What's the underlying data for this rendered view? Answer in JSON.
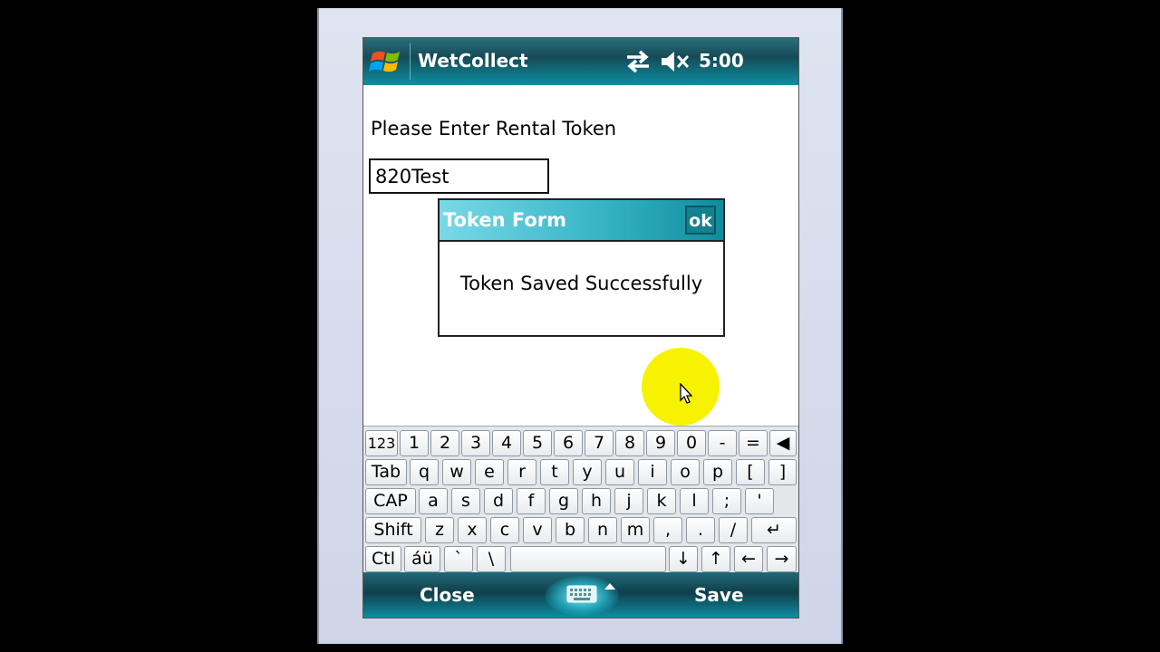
{
  "titlebar": {
    "app_title": "WetCollect",
    "time": "5:00"
  },
  "form": {
    "prompt": "Please Enter Rental Token",
    "token_value": "820Test"
  },
  "dialog": {
    "title": "Token Form",
    "ok_label": "ok",
    "message": "Token Saved Successfully"
  },
  "keyboard": {
    "row1": [
      "123",
      "1",
      "2",
      "3",
      "4",
      "5",
      "6",
      "7",
      "8",
      "9",
      "0",
      "-",
      "=",
      "◀"
    ],
    "row2": [
      "Tab",
      "q",
      "w",
      "e",
      "r",
      "t",
      "y",
      "u",
      "i",
      "o",
      "p",
      "[",
      "]"
    ],
    "row3": [
      "CAP",
      "a",
      "s",
      "d",
      "f",
      "g",
      "h",
      "j",
      "k",
      "l",
      ";",
      "'"
    ],
    "row4": [
      "Shift",
      "z",
      "x",
      "c",
      "v",
      "b",
      "n",
      "m",
      ",",
      ".",
      "/",
      "↵"
    ],
    "row5": [
      "Ctl",
      "áü",
      "`",
      "\\",
      "",
      "↓",
      "↑",
      "←",
      "→"
    ]
  },
  "menubar": {
    "left": "Close",
    "right": "Save"
  },
  "colors": {
    "accent": "#13818f",
    "highlight": "#f6f200"
  }
}
